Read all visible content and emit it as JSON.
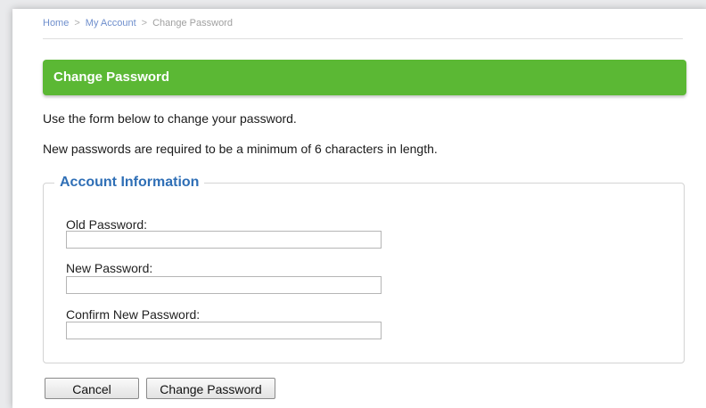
{
  "breadcrumb": {
    "items": [
      "Home",
      "My Account",
      "Change Password"
    ],
    "separator": ">"
  },
  "header": {
    "title": "Change Password",
    "bar_color": "#5bb834"
  },
  "intro": {
    "line1": "Use the form below to change your password.",
    "line2": "New passwords are required to be a minimum of 6 characters in length."
  },
  "account_info": {
    "legend": "Account Information",
    "legend_color": "#2f6fb6",
    "fields": [
      {
        "label": "Old Password:",
        "value": ""
      },
      {
        "label": "New Password:",
        "value": ""
      },
      {
        "label": "Confirm New Password:",
        "value": ""
      }
    ]
  },
  "buttons": {
    "cancel": "Cancel",
    "submit": "Change Password"
  }
}
